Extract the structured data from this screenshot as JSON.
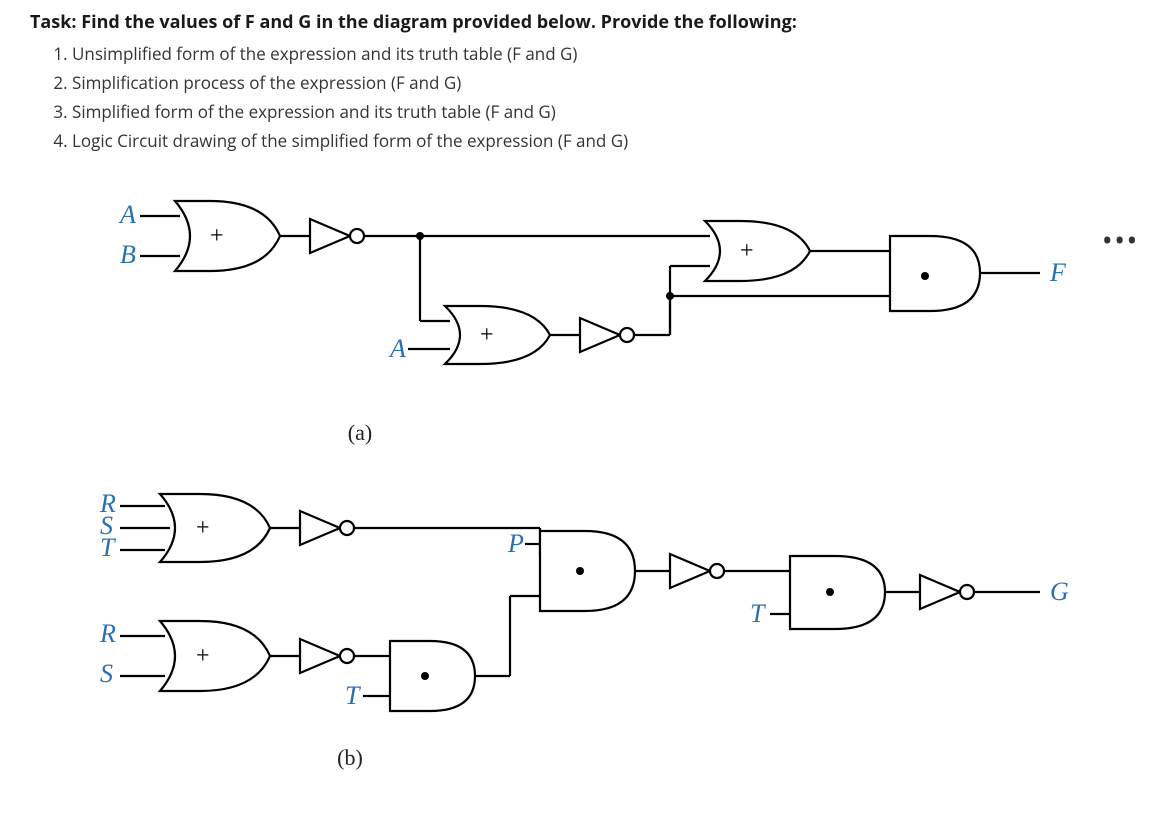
{
  "task": {
    "title": "Task: Find the values of F and G in the diagram provided below. Provide the following:",
    "items": [
      "Unsimplified form of the expression and its truth table (F and G)",
      "Simplification process of the expression (F and G)",
      "Simplified form of the expression and its truth table (F and G)",
      "Logic Circuit drawing of the simplified form of the expression (F and G)"
    ]
  },
  "diagram_a": {
    "label": "(a)",
    "input_A": "A",
    "input_B": "B",
    "mid_A": "A",
    "output_F": "F",
    "plus": "+",
    "dot": "·"
  },
  "diagram_b": {
    "label": "(b)",
    "input_R1": "R",
    "input_S1": "S",
    "input_T1": "T",
    "input_R2": "R",
    "input_S2": "S",
    "input_T2": "T",
    "mid_P": "P",
    "mid_T": "T",
    "output_G": "G",
    "plus": "+",
    "dot": "·"
  },
  "ellipsis": "•••"
}
